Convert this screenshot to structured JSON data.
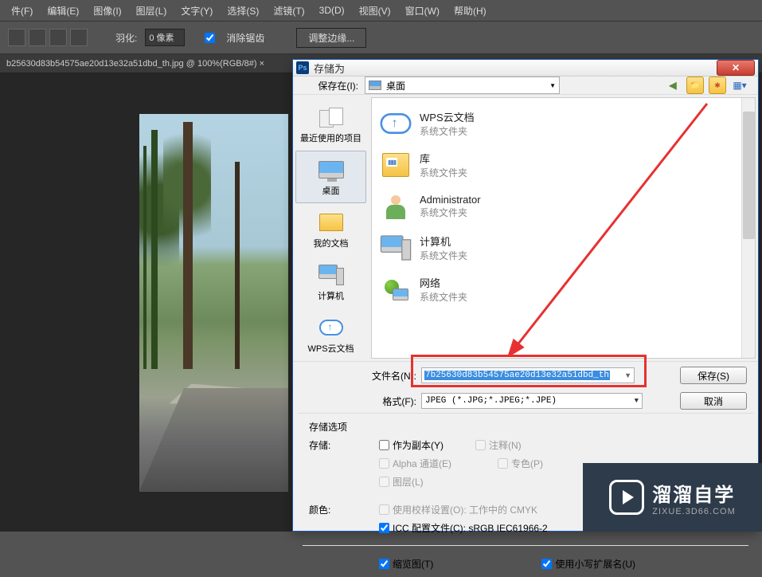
{
  "menubar": [
    "件(F)",
    "编辑(E)",
    "图像(I)",
    "图层(L)",
    "文字(Y)",
    "选择(S)",
    "滤镜(T)",
    "3D(D)",
    "视图(V)",
    "窗口(W)",
    "帮助(H)"
  ],
  "options": {
    "feather_label": "羽化:",
    "feather_value": "0 像素",
    "antialias": "消除锯齿",
    "refine": "调整边缘..."
  },
  "doc_tab": "b25630d83b54575ae20d13e32a51dbd_th.jpg @ 100%(RGB/8#) ×",
  "dialog": {
    "title": "存储为",
    "ps_icon": "Ps",
    "close": "✕",
    "savein_label": "保存在(I):",
    "savein_value": "桌面",
    "places": [
      {
        "icon": "recent",
        "label": "最近使用的项目"
      },
      {
        "icon": "desktop",
        "label": "桌面"
      },
      {
        "icon": "docs",
        "label": "我的文档"
      },
      {
        "icon": "computer",
        "label": "计算机"
      },
      {
        "icon": "cloud",
        "label": "WPS云文档"
      }
    ],
    "files": [
      {
        "icon": "cloud",
        "name": "WPS云文档",
        "sub": "系统文件夹"
      },
      {
        "icon": "lib",
        "name": "库",
        "sub": "系统文件夹"
      },
      {
        "icon": "user",
        "name": "Administrator",
        "sub": "系统文件夹"
      },
      {
        "icon": "computer",
        "name": "计算机",
        "sub": "系统文件夹"
      },
      {
        "icon": "network",
        "name": "网络",
        "sub": "系统文件夹"
      }
    ],
    "filename_label": "文件名(N):",
    "filename_value": "7b25630d83b54575ae20d13e32a51dbd_th",
    "format_label": "格式(F):",
    "format_value": "JPEG (*.JPG;*.JPEG;*.JPE)",
    "save_btn": "保存(S)",
    "cancel_btn": "取消",
    "storage_options": "存储选项",
    "storage": "存储:",
    "as_copy": "作为副本(Y)",
    "notes": "注释(N)",
    "alpha": "Alpha 通道(E)",
    "spot": "专色(P)",
    "layers": "图层(L)",
    "color": "颜色:",
    "proof": "使用校样设置(O):  工作中的 CMYK",
    "icc": "ICC 配置文件(C):  sRGB IEC61966-2",
    "thumb": "缩览图(T)",
    "lowercase": "使用小写扩展名(U)"
  },
  "watermark": {
    "cn": "溜溜自学",
    "en": "ZIXUE.3D66.COM"
  }
}
